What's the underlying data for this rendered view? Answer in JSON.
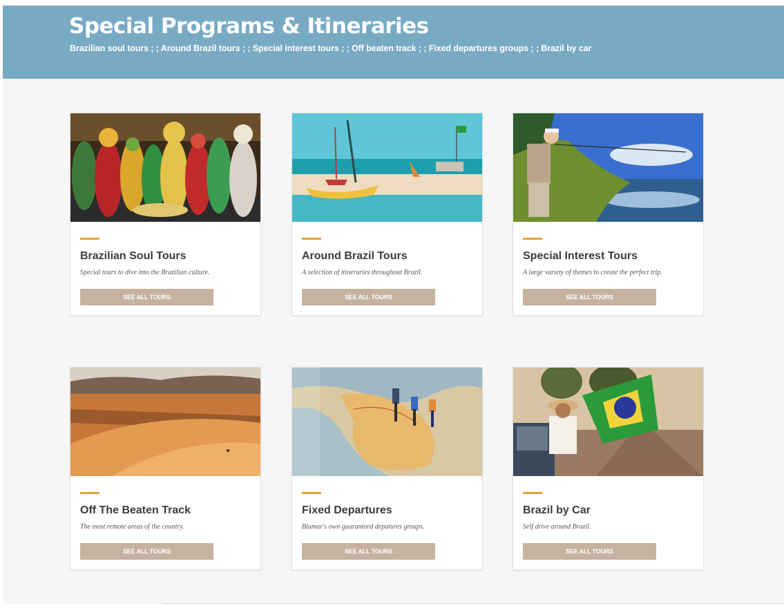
{
  "header": {
    "title": "Special Programs & Itineraries",
    "subtitle_links": "Brazilian soul tours ; ; Around Brazil tours ; ; Special interest tours ; ; Off beaten track ; ; Fixed departures groups ; ; Brazil by car"
  },
  "colors": {
    "header_bg": "#79aac4",
    "accent": "#e9a231",
    "button_bg": "#c5b3a0",
    "page_bg": "#f6f6f6"
  },
  "cards": [
    {
      "title": "Brazilian Soul Tours",
      "description": "Special tours to dive into the Brazilian culture.",
      "button_label": "SEE ALL TOURS",
      "image": "carnival-dancers-photo"
    },
    {
      "title": "Around Brazil Tours",
      "description": "A selection of itineraries throughout Brazil.",
      "button_label": "SEE ALL TOURS",
      "image": "beach-sailboats-photo"
    },
    {
      "title": "Special Interest Tours",
      "description": "A large variety of themes to create the perfect trip.",
      "button_label": "SEE ALL TOURS",
      "image": "river-fishing-photo"
    },
    {
      "title": "Off The Beaten Track",
      "description": "The most remote areas of the country.",
      "button_label": "SEE ALL TOURS",
      "image": "sand-dunes-photo"
    },
    {
      "title": "Fixed Departures",
      "description": "Blumar's own guaranteed depatures groups.",
      "button_label": "SEE ALL TOURS",
      "image": "map-travelers-photo"
    },
    {
      "title": "Brazil by Car",
      "description": "Self drive around Brazil.",
      "button_label": "SEE ALL TOURS",
      "image": "car-brazil-flag-photo"
    }
  ]
}
